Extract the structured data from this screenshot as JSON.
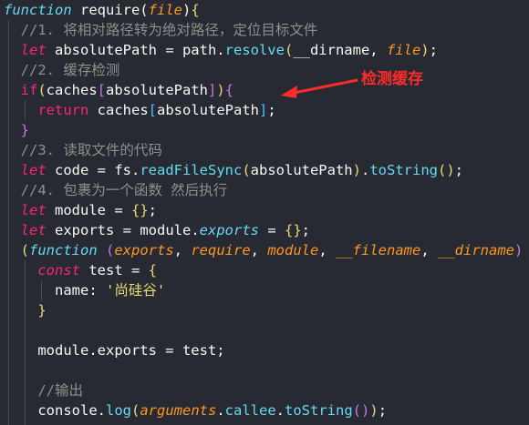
{
  "code_lines": [
    [
      [
        "func-kw",
        "function"
      ],
      [
        "plain",
        " require("
      ],
      [
        "param",
        "file"
      ],
      [
        "plain",
        ")"
      ],
      [
        "br-y",
        "{"
      ]
    ],
    [
      [
        "cm",
        "  //1. 将相对路径转为绝对路径，定位目标文件"
      ]
    ],
    [
      [
        "kw-it",
        "  let"
      ],
      [
        "plain",
        " absolutePath = path."
      ],
      [
        "fn",
        "resolve"
      ],
      [
        "br-y",
        "("
      ],
      [
        "plain",
        "__dirname, "
      ],
      [
        "param",
        "file"
      ],
      [
        "br-y",
        ")"
      ],
      [
        "plain",
        ";"
      ]
    ],
    [
      [
        "cm",
        "  //2. 缓存检测"
      ]
    ],
    [
      [
        "kw",
        "  if"
      ],
      [
        "br-y",
        "("
      ],
      [
        "plain",
        "caches"
      ],
      [
        "br-p",
        "["
      ],
      [
        "plain",
        "absolutePath"
      ],
      [
        "br-p",
        "]"
      ],
      [
        "br-y",
        ")"
      ],
      [
        "br-p",
        "{"
      ]
    ],
    [
      [
        "kw",
        "    return"
      ],
      [
        "plain",
        " caches"
      ],
      [
        "br-b",
        "["
      ],
      [
        "plain",
        "absolutePath"
      ],
      [
        "br-b",
        "]"
      ],
      [
        "plain",
        ";"
      ]
    ],
    [
      [
        "br-p",
        "  }"
      ]
    ],
    [
      [
        "cm",
        "  //3. 读取文件的代码"
      ]
    ],
    [
      [
        "kw-it",
        "  let"
      ],
      [
        "plain",
        " code = fs."
      ],
      [
        "fn",
        "readFileSync"
      ],
      [
        "br-y",
        "("
      ],
      [
        "plain",
        "absolutePath"
      ],
      [
        "br-y",
        ")"
      ],
      [
        "plain",
        "."
      ],
      [
        "fn",
        "toString"
      ],
      [
        "br-y",
        "()"
      ],
      [
        "plain",
        ";"
      ]
    ],
    [
      [
        "cm",
        "  //4. 包裹为一个函数 然后执行"
      ]
    ],
    [
      [
        "kw-it",
        "  let"
      ],
      [
        "plain",
        " module = "
      ],
      [
        "br-y",
        "{}"
      ],
      [
        "plain",
        ";"
      ]
    ],
    [
      [
        "kw-it",
        "  let"
      ],
      [
        "plain",
        " exports = "
      ],
      [
        "plain",
        "module."
      ],
      [
        "prop-it",
        "exports"
      ],
      [
        "plain",
        " = "
      ],
      [
        "br-y",
        "{}"
      ],
      [
        "plain",
        ";"
      ]
    ],
    [
      [
        "br-y",
        "  ("
      ],
      [
        "func-kw",
        "function"
      ],
      [
        "plain",
        " "
      ],
      [
        "br-p",
        "("
      ],
      [
        "param",
        "exports"
      ],
      [
        "plain",
        ", "
      ],
      [
        "param",
        "require"
      ],
      [
        "plain",
        ", "
      ],
      [
        "param",
        "module"
      ],
      [
        "plain",
        ", "
      ],
      [
        "param",
        "__filename"
      ],
      [
        "plain",
        ", "
      ],
      [
        "param",
        "__dirname"
      ],
      [
        "br-p",
        ")"
      ],
      [
        "plain",
        " "
      ],
      [
        "br-b",
        "{"
      ]
    ],
    [
      [
        "kw-it",
        "    const"
      ],
      [
        "plain",
        " test = "
      ],
      [
        "br-y",
        "{"
      ]
    ],
    [
      [
        "plain",
        "      name: "
      ],
      [
        "str",
        "'尚硅谷'"
      ]
    ],
    [
      [
        "br-y",
        "    }"
      ]
    ],
    [
      [
        "plain",
        ""
      ]
    ],
    [
      [
        "plain",
        "    module.exports = test;"
      ]
    ],
    [
      [
        "plain",
        ""
      ]
    ],
    [
      [
        "cm",
        "    //输出"
      ]
    ],
    [
      [
        "plain",
        "    console."
      ],
      [
        "fn",
        "log"
      ],
      [
        "br-y",
        "("
      ],
      [
        "param",
        "arguments"
      ],
      [
        "plain",
        "."
      ],
      [
        "prop",
        "callee"
      ],
      [
        "plain",
        "."
      ],
      [
        "fn",
        "toString"
      ],
      [
        "br-p",
        "()"
      ],
      [
        "br-y",
        ")"
      ],
      [
        "plain",
        ";"
      ]
    ]
  ],
  "annotation": {
    "text": "检测缓存",
    "color": "#ff2a2a"
  },
  "theme": {
    "background": "#282a33",
    "keyword": "#f92672",
    "function": "#66d9ef",
    "param": "#fd971f",
    "string": "#e6db74",
    "comment": "#8f908a"
  }
}
